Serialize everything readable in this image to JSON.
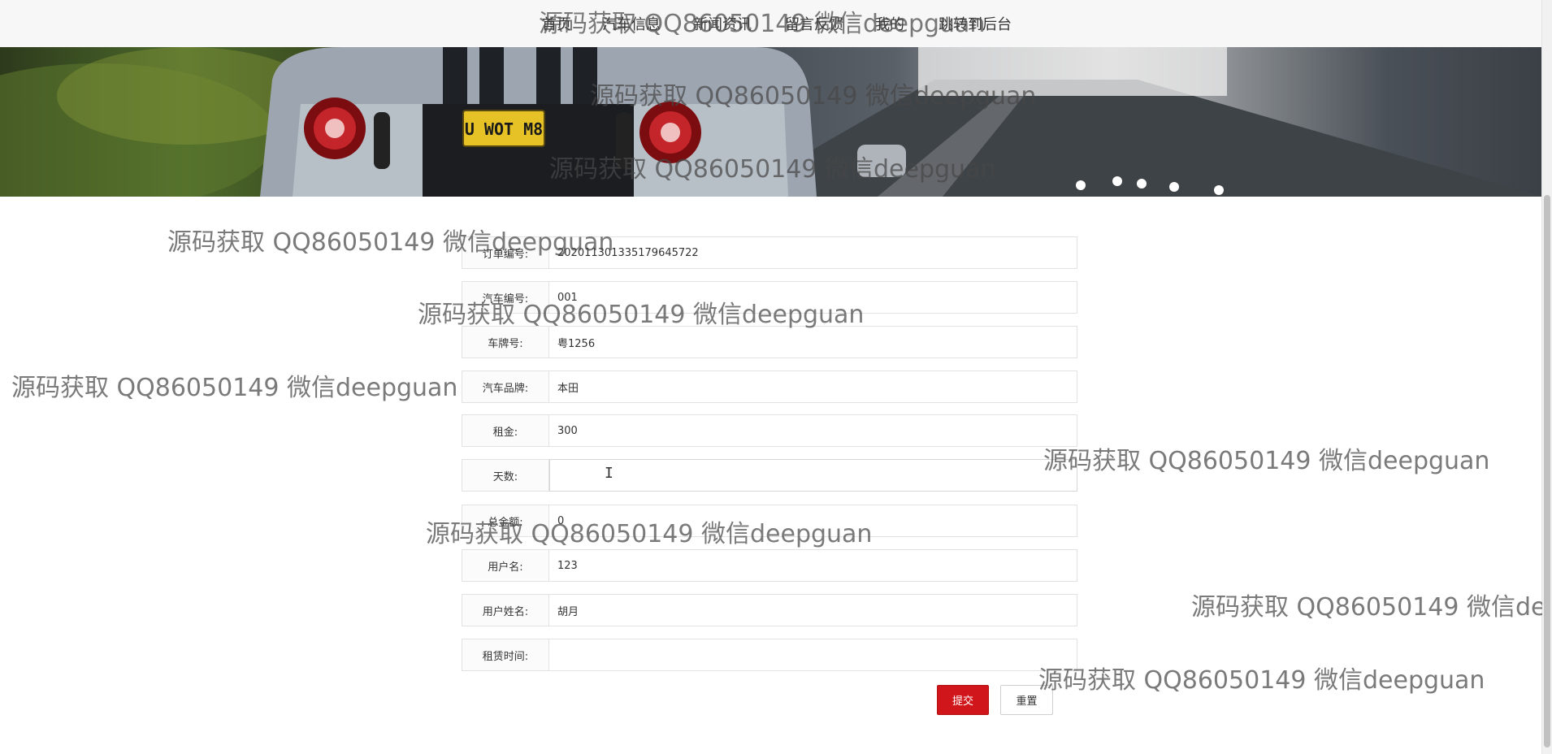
{
  "nav": {
    "items": [
      {
        "label": "首页"
      },
      {
        "label": "汽车信息"
      },
      {
        "label": "新闻资讯"
      },
      {
        "label": "留言反馈"
      },
      {
        "label": "我的"
      },
      {
        "label": "跳转到后台"
      }
    ],
    "active_index": 1,
    "accent_color": "#d0161b"
  },
  "banner": {
    "plate_text": "U WOT M8"
  },
  "form": {
    "fields": [
      {
        "label": "订单编号:",
        "value": "202011301335179645722"
      },
      {
        "label": "汽车编号:",
        "value": "001"
      },
      {
        "label": "车牌号:",
        "value": "粤1256"
      },
      {
        "label": "汽车品牌:",
        "value": "本田"
      },
      {
        "label": "租金:",
        "value": "300"
      },
      {
        "label": "天数:",
        "value": ""
      },
      {
        "label": "总金额:",
        "value": "0"
      },
      {
        "label": "用户名:",
        "value": "123"
      },
      {
        "label": "用户姓名:",
        "value": "胡月"
      },
      {
        "label": "租赁时间:",
        "value": ""
      }
    ],
    "submit_label": "提交",
    "reset_label": "重置"
  },
  "watermark": {
    "text": "源码获取 QQ86050149 微信deepguan"
  }
}
